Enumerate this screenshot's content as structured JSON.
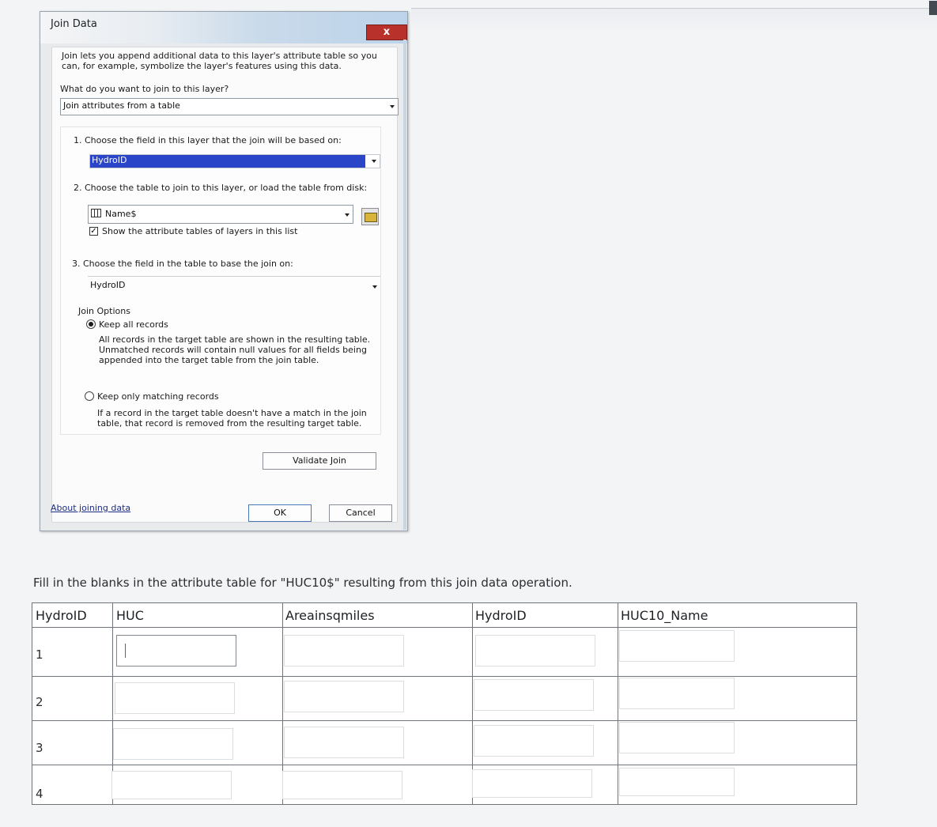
{
  "dialog": {
    "title": "Join Data",
    "close_label": "x",
    "description": "Join lets you append additional data to this layer's attribute table so you can, for example, symbolize the layer's features using this data.",
    "question": "What do you want to join to this layer?",
    "join_type": "Join attributes from a table",
    "step1_label": "1.  Choose the field in this layer that the join will be based on:",
    "step1_value": "HydroID",
    "step2_label": "2.  Choose the table to join to this layer, or load the table from disk:",
    "step2_value": "Name$",
    "show_tables_label": "Show the attribute tables of layers in this list",
    "show_tables_checked": "✓",
    "step3_label": "3.  Choose the field in the table to base the join on:",
    "step3_value": "HydroID",
    "join_options_label": "Join Options",
    "keep_all_label": "Keep all records",
    "keep_all_note": "All records in the target table are shown in the resulting table. Unmatched records will contain null values for all fields being appended into the target table from the join table.",
    "keep_matching_label": "Keep only matching records",
    "keep_matching_note": "If a record in the target table doesn't have a match in the join table, that record is removed from the resulting target table.",
    "validate_label": "Validate Join",
    "about_link": "About joining data",
    "ok_label": "OK",
    "cancel_label": "Cancel"
  },
  "prompt": "Fill in the blanks in the attribute table for \"HUC10$\" resulting from this join data operation.",
  "table": {
    "headers": [
      "HydroID",
      "HUC",
      "Areainsqmiles",
      "HydroID",
      "HUC10_Name"
    ],
    "rows": [
      "1",
      "2",
      "3",
      "4"
    ]
  }
}
